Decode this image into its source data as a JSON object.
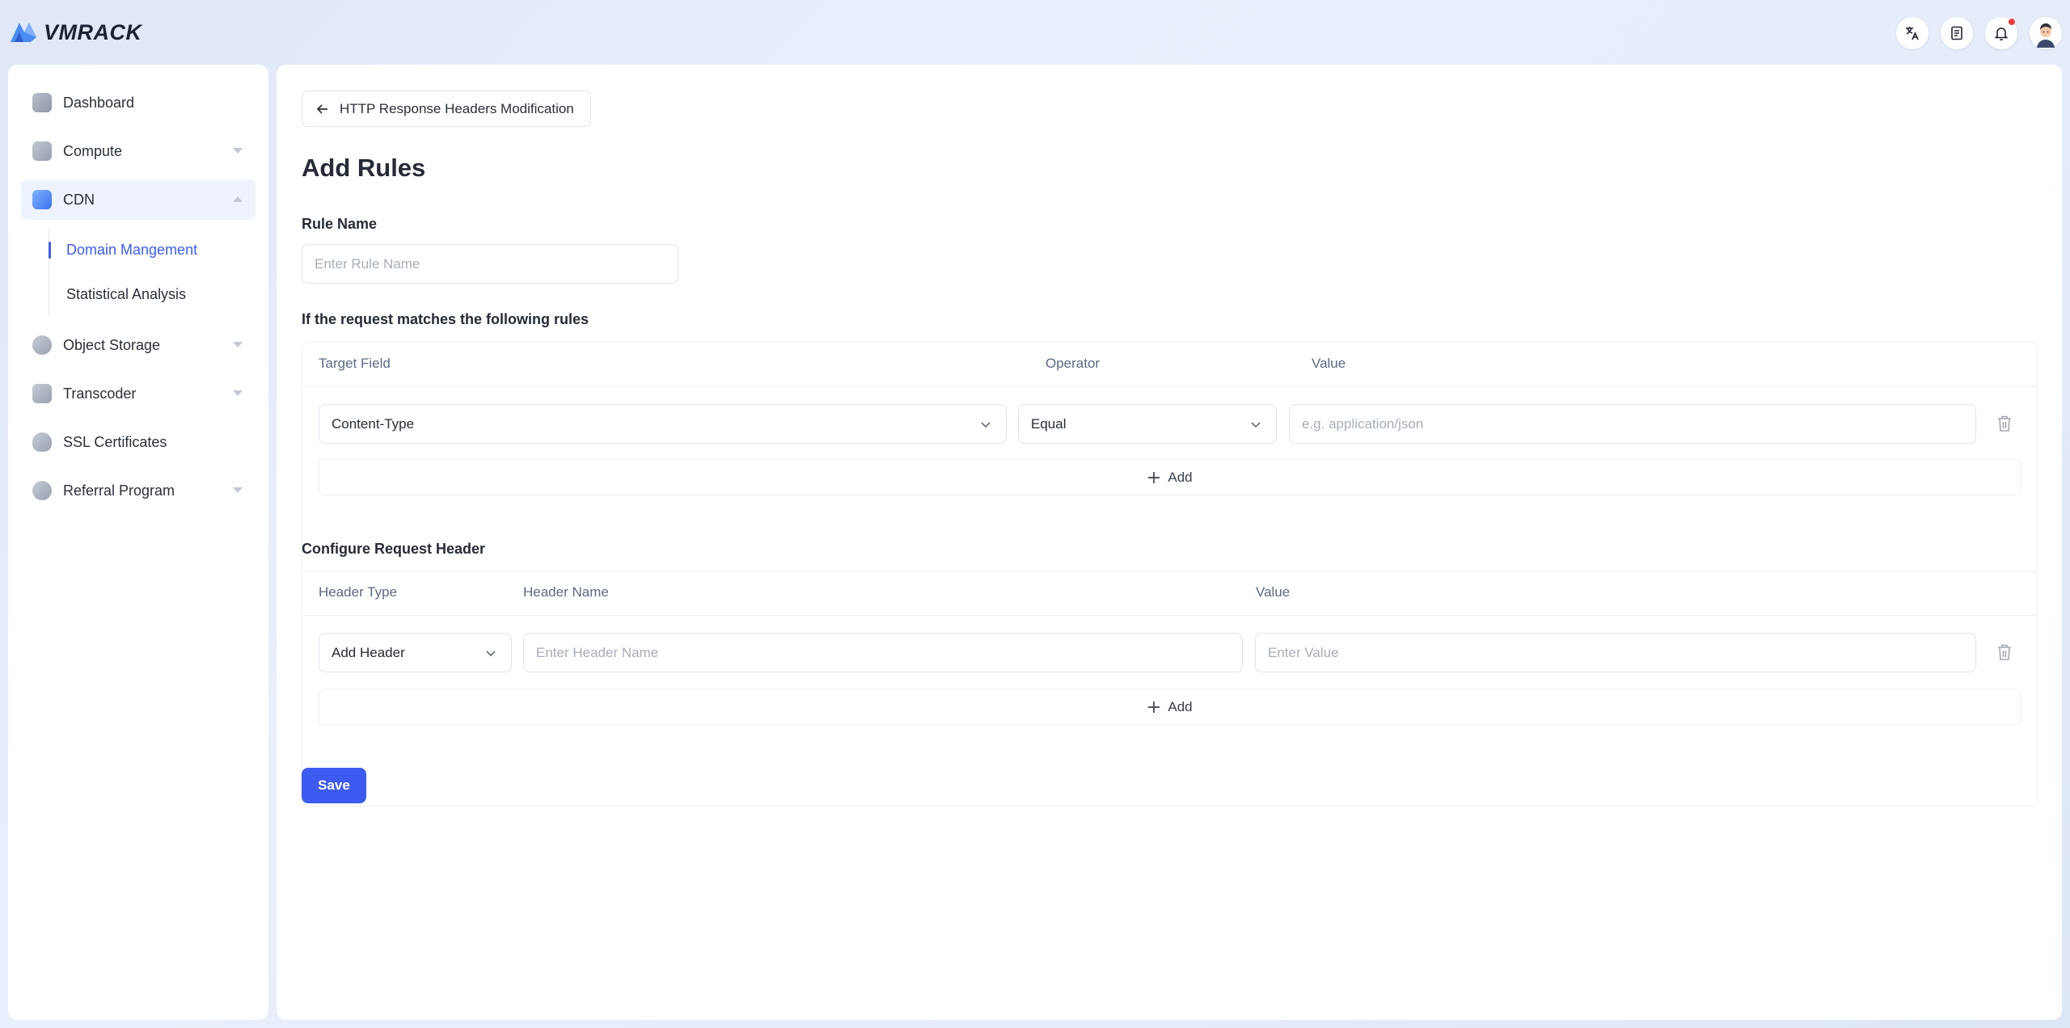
{
  "app": {
    "brand": "VMRACK"
  },
  "colors": {
    "accent": "#3d5bf0",
    "notification": "#f03a3a"
  },
  "topbar": {
    "icons": [
      "translate-icon",
      "document-icon",
      "bell-icon",
      "avatar"
    ]
  },
  "sidebar": {
    "items": [
      {
        "label": "Dashboard",
        "icon": "dashboard-icon"
      },
      {
        "label": "Compute",
        "icon": "compute-icon"
      },
      {
        "label": "CDN",
        "icon": "cdn-icon"
      },
      {
        "label": "Object Storage",
        "icon": "object-storage-icon"
      },
      {
        "label": "Transcoder",
        "icon": "transcoder-icon"
      },
      {
        "label": "SSL Certificates",
        "icon": "ssl-icon"
      },
      {
        "label": "Referral Program",
        "icon": "referral-icon"
      }
    ],
    "cdn_sub": [
      "Domain Mangement",
      "Statistical Analysis"
    ]
  },
  "main": {
    "back_label": "HTTP Response Headers Modification",
    "title": "Add Rules",
    "rule_name": {
      "label": "Rule Name",
      "placeholder": "Enter Rule Name"
    },
    "match_section": {
      "label": "If the request matches the following rules",
      "columns": [
        "Target Field",
        "Operator",
        "Value"
      ],
      "row": {
        "target_field": "Content-Type",
        "operator": "Equal",
        "value_placeholder": "e.g. application/json"
      },
      "add_label": "Add"
    },
    "header_section": {
      "label": "Configure Request Header",
      "columns": [
        "Header Type",
        "Header Name",
        "Value"
      ],
      "row": {
        "header_type": "Add Header",
        "name_placeholder": "Enter Header Name",
        "value_placeholder": "Enter Value"
      },
      "add_label": "Add"
    },
    "save_label": "Save"
  }
}
